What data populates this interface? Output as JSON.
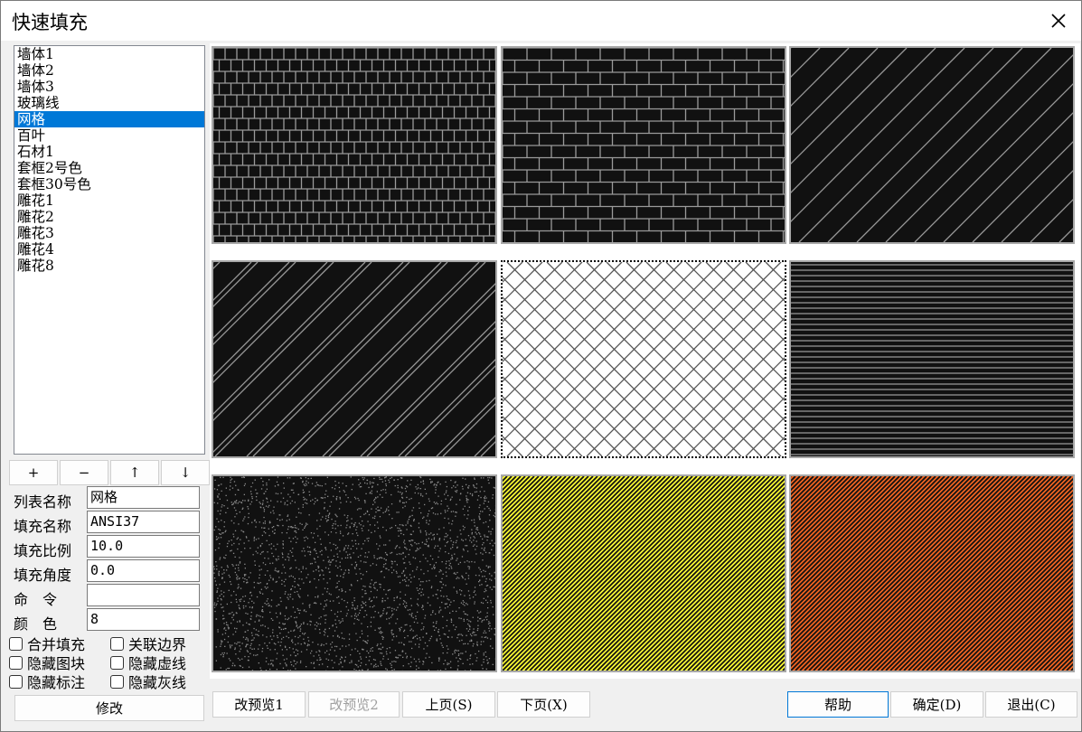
{
  "window": {
    "title": "快速填充"
  },
  "list": {
    "items": [
      "墙体1",
      "墙体2",
      "墙体3",
      "玻璃线",
      "网格",
      "百叶",
      "石材1",
      "套框2号色",
      "套框30号色",
      "雕花1",
      "雕花2",
      "雕花3",
      "雕花4",
      "雕花8"
    ],
    "selected_index": 4
  },
  "list_buttons": {
    "add": "+",
    "remove": "−",
    "up": "↑",
    "down": "↓"
  },
  "form": {
    "list_name_label": "列表名称",
    "list_name_value": "网格",
    "fill_name_label": "填充名称",
    "fill_name_value": "ANSI37",
    "fill_scale_label": "填充比例",
    "fill_scale_value": "10.0",
    "fill_angle_label": "填充角度",
    "fill_angle_value": "0.0",
    "command_label": "命　令",
    "command_value": "",
    "color_label": "颜　色",
    "color_value": "8"
  },
  "checkboxes": {
    "merge_fill": "合并填充",
    "link_boundary": "关联边界",
    "hide_blocks": "隐藏图块",
    "hide_dashed": "隐藏虚线",
    "hide_dims": "隐藏标注",
    "hide_gray": "隐藏灰线"
  },
  "buttons": {
    "modify": "修改",
    "change_preview1": "改预览1",
    "change_preview2": "改预览2",
    "prev_page": "上页(S)",
    "next_page": "下页(X)",
    "help": "帮助",
    "ok": "确定(D)",
    "exit": "退出(C)"
  },
  "previews": [
    {
      "pattern": "brick-small",
      "background": "#111111",
      "line_color": "#9a9a9a"
    },
    {
      "pattern": "brick-large",
      "background": "#111111",
      "line_color": "#9a9a9a"
    },
    {
      "pattern": "diagonal-sparse",
      "background": "#111111",
      "line_color": "#9a9a9a"
    },
    {
      "pattern": "diagonal-pairs",
      "background": "#111111",
      "line_color": "#9a9a9a"
    },
    {
      "pattern": "crosshatch",
      "background": "#ffffff",
      "line_color": "#555555",
      "selected": true
    },
    {
      "pattern": "horizontal-lines",
      "background": "#111111",
      "line_color": "#9a9a9a"
    },
    {
      "pattern": "speckle",
      "background": "#111111",
      "line_color": "#8a8a8a"
    },
    {
      "pattern": "diagonal-dense",
      "background": "#ffff33",
      "line_color": "#111111"
    },
    {
      "pattern": "diagonal-dense",
      "background": "#f26522",
      "line_color": "#111111"
    }
  ]
}
